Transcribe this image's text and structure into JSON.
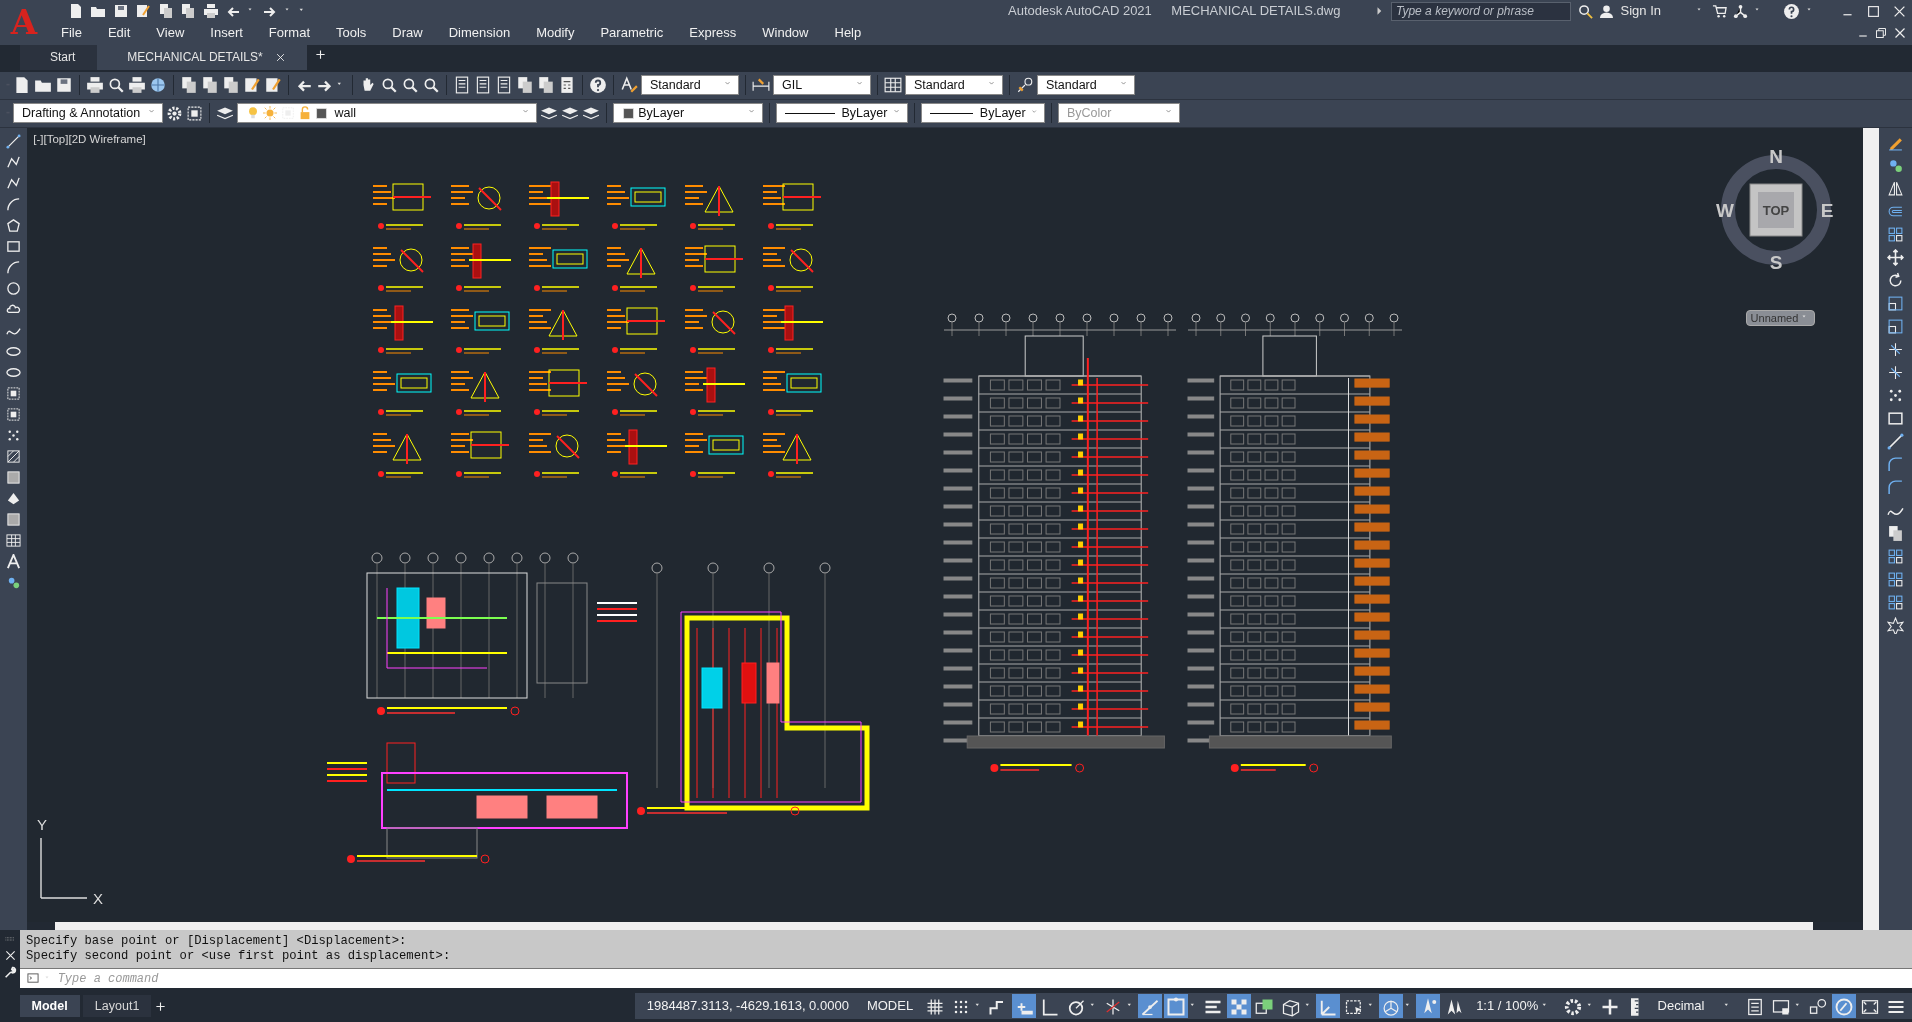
{
  "title_bar": {
    "logo": "A",
    "app_title": "Autodesk AutoCAD 2021",
    "file_name": "MECHANICAL DETAILS.dwg",
    "search": {
      "placeholder": "Type a keyword or phrase"
    },
    "sign_in": "Sign In"
  },
  "menu": [
    "File",
    "Edit",
    "View",
    "Insert",
    "Format",
    "Tools",
    "Draw",
    "Dimension",
    "Modify",
    "Parametric",
    "Express",
    "Window",
    "Help"
  ],
  "file_tabs": [
    {
      "label": "Start",
      "selected": false
    },
    {
      "label": "MECHANICAL DETAILS*",
      "selected": true
    }
  ],
  "styles_toolbar": {
    "text_style": "Standard",
    "dimension_style": "GIL",
    "table_style": "Standard",
    "multileader_style": "Standard"
  },
  "layers_toolbar": {
    "workspace": "Drafting & Annotation",
    "layer": "wall",
    "object_color": "ByLayer",
    "linetype": "ByLayer",
    "lineweight": "ByLayer",
    "plot_style": {
      "value": "ByColor",
      "disabled": true
    }
  },
  "viewport": {
    "label": "[-][Top][2D Wireframe]",
    "viewcube": {
      "north": "N",
      "south": "S",
      "east": "E",
      "west": "W",
      "face": "TOP",
      "ucs": "Unnamed"
    },
    "ucs_icon": {
      "x_axis": "X",
      "y_axis": "Y"
    }
  },
  "command_history": [
    "Specify base point or [Displacement] <Displacement>:",
    "Specify second point or <use first point as displacement>:"
  ],
  "command_line": {
    "placeholder": "Type a command"
  },
  "layout_tabs": [
    {
      "label": "Model",
      "selected": true
    },
    {
      "label": "Layout1",
      "selected": false
    }
  ],
  "status_bar": {
    "coordinates": "1984487.3113, -4629.1613, 0.0000",
    "space": "MODEL",
    "toggles": [
      {
        "kind": "grid",
        "on": false,
        "menu": false
      },
      {
        "kind": "snap",
        "on": false,
        "menu": true
      },
      {
        "kind": "dynamic-input",
        "on": false,
        "menu": false
      },
      {
        "kind": "infer",
        "on": true,
        "menu": false
      },
      {
        "kind": "ortho",
        "on": false,
        "menu": false
      },
      {
        "kind": "polar",
        "on": false,
        "menu": true
      },
      {
        "kind": "isodraft",
        "on": false,
        "menu": true
      },
      {
        "kind": "tracking",
        "on": true,
        "menu": false
      },
      {
        "kind": "osnap",
        "on": true,
        "menu": true
      },
      {
        "kind": "lineweight",
        "on": false,
        "menu": false
      },
      {
        "kind": "transparency",
        "on": true,
        "menu": false
      },
      {
        "kind": "cycling",
        "on": false,
        "menu": false
      },
      {
        "kind": "osnap3d",
        "on": false,
        "menu": true
      },
      {
        "kind": "dynamic-ucs",
        "on": true,
        "menu": false
      },
      {
        "kind": "selection-filter",
        "on": false,
        "menu": true
      },
      {
        "kind": "gizmo",
        "on": true,
        "menu": true
      },
      {
        "kind": "annotation-visibility",
        "on": true,
        "menu": false
      },
      {
        "kind": "autoscale",
        "on": false,
        "menu": false
      }
    ],
    "annotation_scale": "1:1 / 100%",
    "tools": [
      {
        "kind": "workspace",
        "on": false,
        "menu": true
      },
      {
        "kind": "annotation-monitor",
        "on": false,
        "menu": false
      },
      {
        "kind": "units",
        "on": false,
        "menu": false
      }
    ],
    "units": "Decimal",
    "toggles_right": [
      {
        "kind": "quick-properties",
        "on": false,
        "menu": false
      },
      {
        "kind": "lock-ui",
        "on": false,
        "menu": true
      },
      {
        "kind": "isolate",
        "on": false,
        "menu": false
      },
      {
        "kind": "hardware",
        "on": true,
        "menu": false
      },
      {
        "kind": "clean-screen",
        "on": false,
        "menu": false
      },
      {
        "kind": "customize",
        "on": false,
        "menu": false
      }
    ]
  }
}
